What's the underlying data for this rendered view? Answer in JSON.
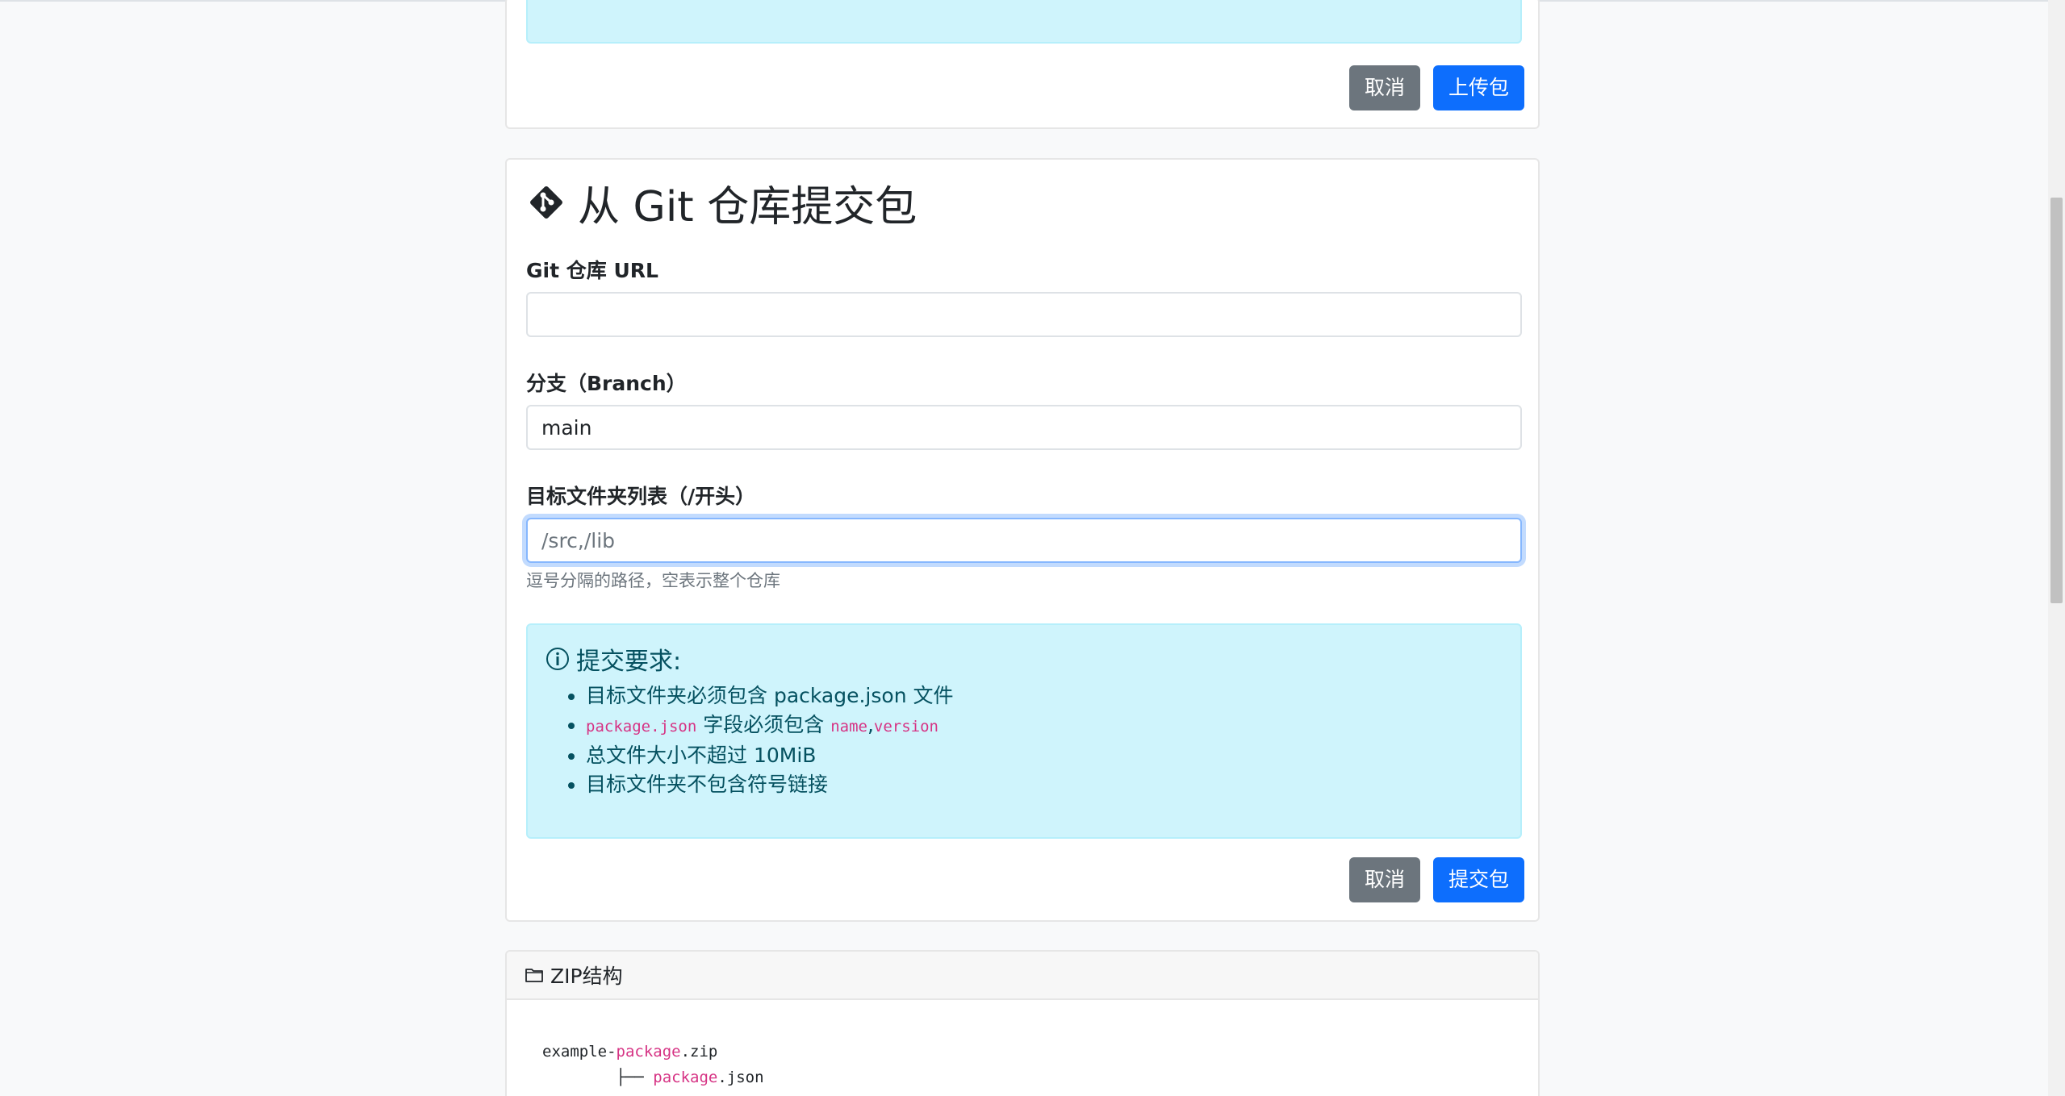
{
  "upload_section": {
    "cancel_label": "取消",
    "upload_label": "上传包"
  },
  "git_section": {
    "title": "从 Git 仓库提交包",
    "repo_url": {
      "label": "Git 仓库 URL",
      "value": "",
      "placeholder": ""
    },
    "branch": {
      "label": "分支（Branch）",
      "value": "main"
    },
    "folders": {
      "label": "目标文件夹列表（/开头）",
      "placeholder": "/src,/lib",
      "help": "逗号分隔的路径，空表示整个仓库"
    },
    "requirements": {
      "heading": "提交要求:",
      "items": [
        "目标文件夹必须包含 package.json 文件",
        {
          "code1": "package.json",
          "text": " 字段必须包含 ",
          "code2": "name",
          "sep": ",",
          "code3": "version"
        },
        "总文件大小不超过 10MiB",
        "目标文件夹不包含符号链接"
      ]
    },
    "cancel_label": "取消",
    "submit_label": "提交包"
  },
  "zip_section": {
    "header": "ZIP结构",
    "tree": {
      "line1_prefix": "example-",
      "line1_hl": "package",
      "line1_suffix": ".zip",
      "line2_prefix": "        ├── ",
      "line2_hl": "package",
      "line2_suffix": ".json"
    }
  },
  "colors": {
    "primary": "#0d6efd",
    "secondary": "#6c757d",
    "info_bg": "#cff4fc",
    "code": "#d63384"
  }
}
